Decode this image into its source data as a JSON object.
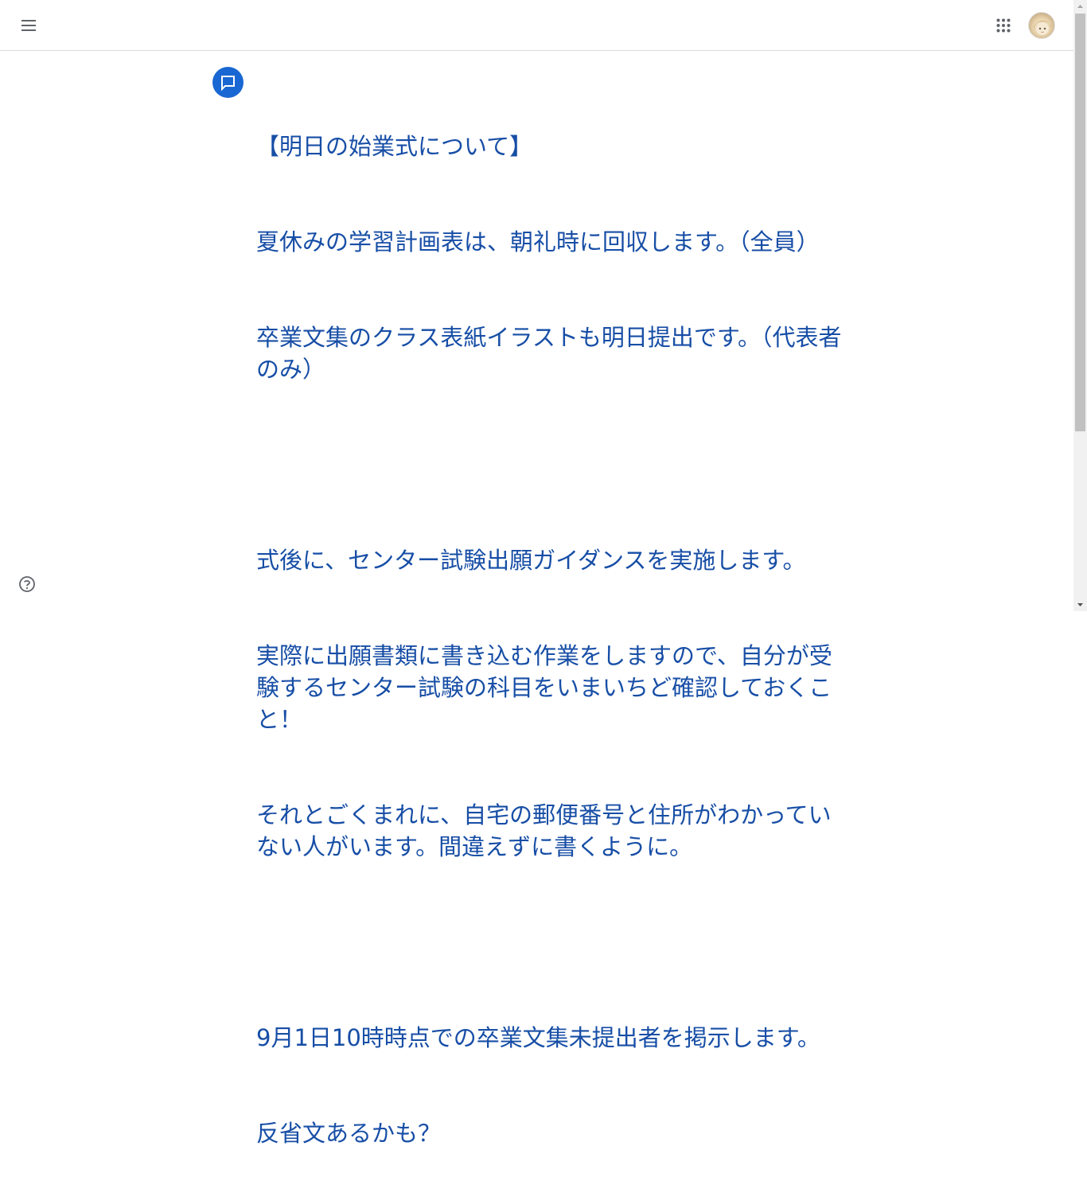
{
  "header": {
    "menu_icon": "hamburger-menu-icon",
    "apps_icon": "google-apps-grid-icon",
    "avatar_icon": "user-avatar"
  },
  "post": {
    "icon": "announcement-comment-icon",
    "accent_color": "#1967d2",
    "text_color": "#174ea6",
    "lines": [
      "【明日の始業式について】",
      "夏休みの学習計画表は、朝礼時に回収します。（全員）",
      "卒業文集のクラス表紙イラストも明日提出です。（代表者のみ）",
      "",
      "式後に、センター試験出願ガイダンスを実施します。",
      "実際に出願書類に書き込む作業をしますので、自分が受験するセンター試験の科目をいまいちど確認しておくこと！",
      "それとごくまれに、自宅の郵便番号と住所がわかっていない人がいます。間違えずに書くように。",
      "",
      "9月1日10時時点での卒業文集未提出者を掲示します。",
      "反省文あるかも？"
    ]
  },
  "footer": {
    "help_icon": "help-question-icon"
  }
}
